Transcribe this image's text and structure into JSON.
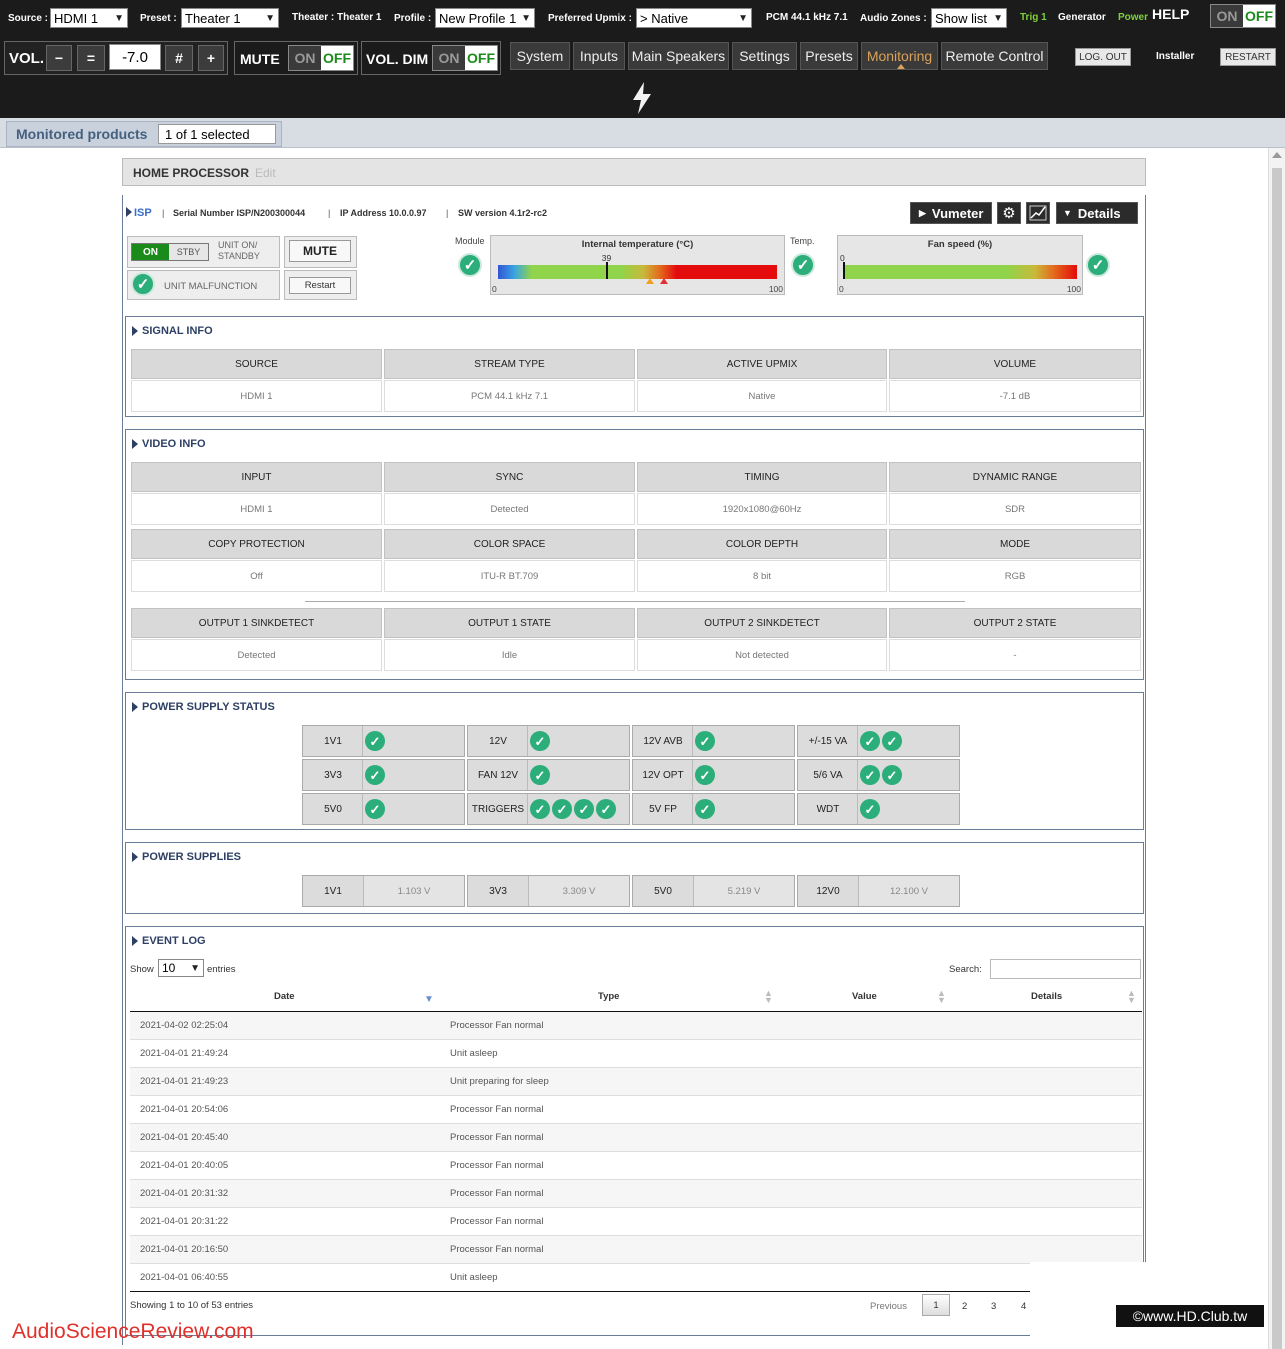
{
  "topbar": {
    "source_label": "Source :",
    "source_value": "HDMI 1",
    "preset_label": "Preset :",
    "preset_value": "Theater 1",
    "theater_label": "Theater : Theater 1",
    "profile_label": "Profile :",
    "profile_value": "New Profile 1",
    "upmix_label": "Preferred Upmix :",
    "upmix_value": "> Native",
    "stream_label": "PCM 44.1 kHz 7.1",
    "zones_label": "Audio Zones :",
    "zones_value": "Show list",
    "trig_label": "Trig 1",
    "generator_label": "Generator",
    "power_label": "Power",
    "help_label": "HELP",
    "help_on": "ON",
    "help_off": "OFF",
    "vol_label": "VOL.",
    "vol_value": "-7.0",
    "mute_label": "MUTE",
    "mute_on": "ON",
    "mute_off": "OFF",
    "voldim_label": "VOL. DIM",
    "voldim_on": "ON",
    "voldim_off": "OFF",
    "tabs": [
      "System",
      "Inputs",
      "Main Speakers",
      "Settings",
      "Presets",
      "Monitoring",
      "Remote Control"
    ],
    "logout_label": "LOG. OUT",
    "installer_label": "Installer",
    "restart_label": "RESTART"
  },
  "monitor": {
    "label": "Monitored products",
    "selected": "1 of 1 selected"
  },
  "panel": {
    "title": "HOME PROCESSOR",
    "edit": "Edit",
    "isp": "ISP",
    "serial": "Serial Number ISP/N200300044",
    "ip": "IP Address 10.0.0.97",
    "sw": "SW version 4.1r2-rc2",
    "vumeter": "Vumeter",
    "details": "Details",
    "on": "ON",
    "stby": "STBY",
    "unit_on_standby": "UNIT ON/ STANDBY",
    "mute": "MUTE",
    "malfunction": "UNIT MALFUNCTION",
    "restart": "Restart",
    "module_label": "Module",
    "temp_title": "Internal temperature (°C)",
    "temp_value": 39,
    "temp_min": "0",
    "temp_max": "100",
    "temp_label": "Temp.",
    "fan_title": "Fan speed (%)",
    "fan_value": 0,
    "fan_min": "0",
    "fan_max": "100",
    "fan_top": "0"
  },
  "signal": {
    "title": "SIGNAL INFO",
    "headers": [
      "SOURCE",
      "STREAM TYPE",
      "ACTIVE UPMIX",
      "VOLUME"
    ],
    "values": [
      "HDMI 1",
      "PCM 44.1 kHz 7.1",
      "Native",
      "-7.1 dB"
    ]
  },
  "video": {
    "title": "VIDEO INFO",
    "headers1": [
      "INPUT",
      "SYNC",
      "TIMING",
      "DYNAMIC RANGE"
    ],
    "values1": [
      "HDMI 1",
      "Detected",
      "1920x1080@60Hz",
      "SDR"
    ],
    "headers2": [
      "COPY PROTECTION",
      "COLOR SPACE",
      "COLOR DEPTH",
      "MODE"
    ],
    "values2": [
      "Off",
      "ITU-R BT.709",
      "8 bit",
      "RGB"
    ],
    "headers3": [
      "OUTPUT 1 SINKDETECT",
      "OUTPUT 1 STATE",
      "OUTPUT 2 SINKDETECT",
      "OUTPUT 2 STATE"
    ],
    "values3": [
      "Detected",
      "Idle",
      "Not detected",
      "-"
    ]
  },
  "power_status": {
    "title": "POWER SUPPLY STATUS",
    "rows": [
      [
        {
          "label": "1V1",
          "checks": 1
        },
        {
          "label": "12V",
          "checks": 1
        },
        {
          "label": "12V AVB",
          "checks": 1
        },
        {
          "label": "+/-15 VA",
          "checks": 2
        }
      ],
      [
        {
          "label": "3V3",
          "checks": 1
        },
        {
          "label": "FAN 12V",
          "checks": 1
        },
        {
          "label": "12V OPT",
          "checks": 1
        },
        {
          "label": "5/6 VA",
          "checks": 2
        }
      ],
      [
        {
          "label": "5V0",
          "checks": 1
        },
        {
          "label": "TRIGGERS",
          "checks": 4
        },
        {
          "label": "5V FP",
          "checks": 1
        },
        {
          "label": "WDT",
          "checks": 1
        }
      ]
    ]
  },
  "power_supplies": {
    "title": "POWER SUPPLIES",
    "items": [
      {
        "label": "1V1",
        "value": "1.103 V"
      },
      {
        "label": "3V3",
        "value": "3.309 V"
      },
      {
        "label": "5V0",
        "value": "5.219 V"
      },
      {
        "label": "12V0",
        "value": "12.100 V"
      }
    ]
  },
  "event_log": {
    "title": "EVENT LOG",
    "show_label": "Show",
    "show_value": "10",
    "entries_label": "entries",
    "search_label": "Search:",
    "columns": [
      "Date",
      "Type",
      "Value",
      "Details"
    ],
    "rows": [
      {
        "date": "2021-04-02 02:25:04",
        "type": "Processor Fan normal"
      },
      {
        "date": "2021-04-01 21:49:24",
        "type": "Unit asleep"
      },
      {
        "date": "2021-04-01 21:49:23",
        "type": "Unit preparing for sleep"
      },
      {
        "date": "2021-04-01 20:54:06",
        "type": "Processor Fan normal"
      },
      {
        "date": "2021-04-01 20:45:40",
        "type": "Processor Fan normal"
      },
      {
        "date": "2021-04-01 20:40:05",
        "type": "Processor Fan normal"
      },
      {
        "date": "2021-04-01 20:31:32",
        "type": "Processor Fan normal"
      },
      {
        "date": "2021-04-01 20:31:22",
        "type": "Processor Fan normal"
      },
      {
        "date": "2021-04-01 20:16:50",
        "type": "Processor Fan normal"
      },
      {
        "date": "2021-04-01 06:40:55",
        "type": "Unit asleep"
      }
    ],
    "showing": "Showing 1 to 10 of 53 entries",
    "previous": "Previous",
    "pages": [
      "1",
      "2",
      "3",
      "4"
    ]
  },
  "watermarks": {
    "left": "AudioScienceReview.com",
    "right": "©www.HD.Club.tw"
  }
}
